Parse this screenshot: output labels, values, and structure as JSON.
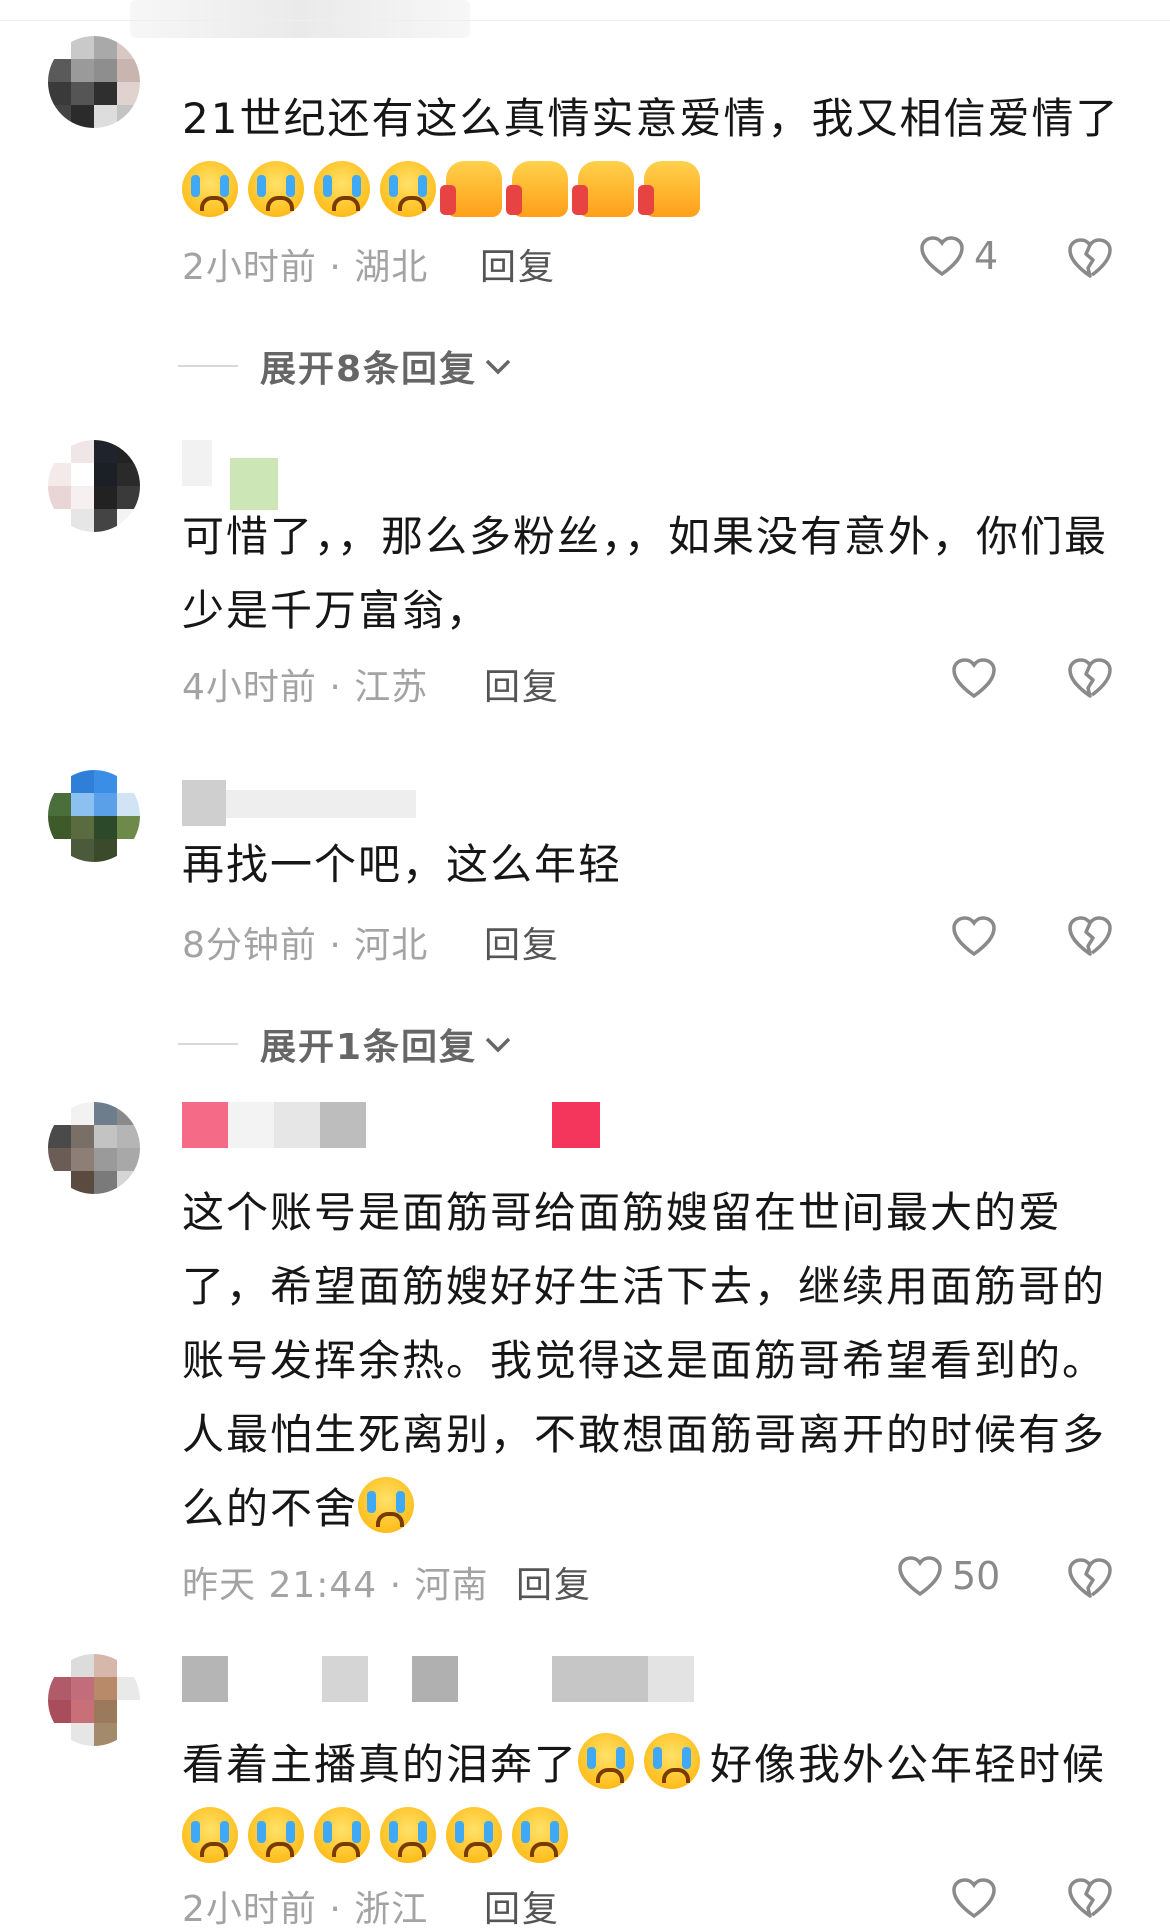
{
  "comments": [
    {
      "text": "21世纪还有这么真情实意爱情，我又相信爱情了",
      "emojis": [
        "cry",
        "cry",
        "cry",
        "cry",
        "thumb",
        "thumb",
        "thumb",
        "thumb"
      ],
      "meta": "2小时前 · 湖北",
      "reply": "回复",
      "likes": "4",
      "expand": "展开8条回复"
    },
    {
      "username": "",
      "text": "可惜了，，那么多粉丝，，如果没有意外，你们最少是千万富翁，",
      "meta": "4小时前 · 江苏",
      "reply": "回复",
      "likes": ""
    },
    {
      "text": "再找一个吧，这么年轻",
      "meta": "8分钟前 · 河北",
      "reply": "回复",
      "likes": "",
      "expand": "展开1条回复"
    },
    {
      "text": "这个账号是面筋哥给面筋嫂留在世间最大的爱了，希望面筋嫂好好生活下去，继续用面筋哥的账号发挥余热。我觉得这是面筋哥希望看到的。人最怕生死离别，不敢想面筋哥离开的时候有多么的不舍",
      "meta": "昨天 21:44 · 河南",
      "reply": "回复",
      "likes": "50"
    },
    {
      "text_a": "看着主播真的泪奔了",
      "text_b": "好像我外公年轻时候",
      "meta": "2小时前 · 浙江",
      "reply": "回复"
    }
  ],
  "icons": {
    "like": "heart-outline-icon",
    "dislike": "broken-heart-icon",
    "expand": "chevron-down-icon",
    "emoji_cry": "crying-face-emoji",
    "emoji_thumb": "thumbs-up-emoji"
  },
  "colors": {
    "text": "#161616",
    "meta": "#a3a3a3",
    "icon": "#8a8a8a",
    "accent_red": "#f5365c"
  }
}
